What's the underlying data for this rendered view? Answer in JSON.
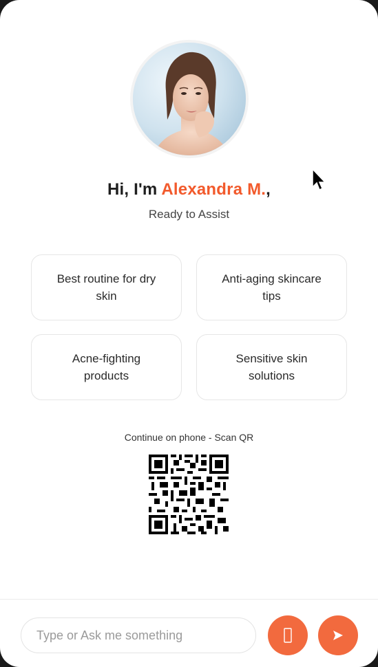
{
  "header": {
    "greeting_prefix": "Hi, I'm ",
    "assistant_name": "Alexandra M.",
    "greeting_suffix": ",",
    "subtitle": "Ready to Assist"
  },
  "suggestions": [
    {
      "label": "Best routine for dry skin"
    },
    {
      "label": "Anti-aging skincare tips"
    },
    {
      "label": "Acne-fighting products"
    },
    {
      "label": "Sensitive skin solutions"
    }
  ],
  "qr": {
    "label": "Continue on phone - Scan QR"
  },
  "composer": {
    "placeholder": "Type or Ask me something",
    "mic_icon": "mic-icon",
    "send_icon": "send-icon"
  },
  "colors": {
    "accent": "#f25a2c",
    "button": "#f26a3e"
  }
}
